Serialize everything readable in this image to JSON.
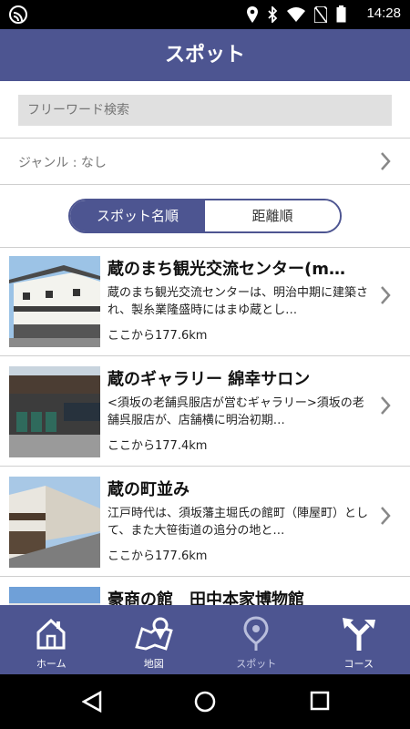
{
  "status": {
    "time": "14:28"
  },
  "header": {
    "title": "スポット"
  },
  "search": {
    "placeholder": "フリーワード検索"
  },
  "genre": {
    "label": "ジャンル : なし"
  },
  "sort": {
    "options": [
      "スポット名順",
      "距離順"
    ],
    "selected": "スポット名順"
  },
  "spots": [
    {
      "name": "蔵のまち観光交流センター(m…",
      "desc": "蔵のまち観光交流センターは、明治中期に建築され、製糸業隆盛時にはまゆ蔵とし…",
      "distance": "ここから177.6km"
    },
    {
      "name": "蔵のギャラリー 綿幸サロン",
      "desc": "<須坂の老舗呉服店が営むギャラリー>須坂の老舗呉服店が、店舗横に明治初期…",
      "distance": "ここから177.4km"
    },
    {
      "name": "蔵の町並み",
      "desc": "江戸時代は、須坂藩主堀氏の館町（陣屋町）として、また大笹街道の追分の地と…",
      "distance": "ここから177.6km"
    },
    {
      "name": "豪商の館　田中本家博物館",
      "desc": "",
      "distance": ""
    }
  ],
  "nav": {
    "items": [
      {
        "label": "ホーム",
        "icon": "home-icon"
      },
      {
        "label": "地図",
        "icon": "map-icon"
      },
      {
        "label": "スポット",
        "icon": "pin-icon"
      },
      {
        "label": "コース",
        "icon": "route-icon"
      }
    ],
    "active": "スポット"
  },
  "colors": {
    "primary": "#4d5591",
    "divider": "#cfcfcf",
    "search_bg": "#e0e0e0"
  }
}
